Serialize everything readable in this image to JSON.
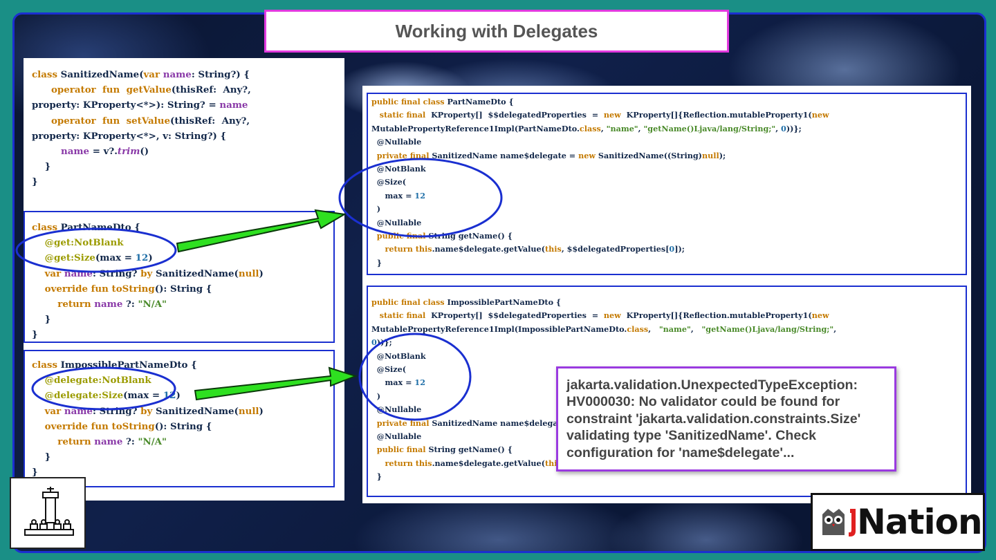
{
  "slide": {
    "title": "Working with Delegates"
  },
  "error": {
    "lines": [
      "jakarta.validation.UnexpectedTypeException:",
      "HV000030: No validator could be found for",
      "constraint 'jakarta.validation.constraints.Size'",
      "validating type 'SanitizedName'. Check",
      "configuration for 'name$delegate'..."
    ]
  },
  "branding": {
    "conference": "JNation",
    "left_logo_icon": "chess-pieces-icon",
    "right_logo_icon": "owl-icon"
  },
  "colors": {
    "title_border": "#e23adf",
    "frame_border": "#1a2fd0",
    "arrow_fill": "#2ee020",
    "error_border": "#9a3ae0",
    "keyword": "#c47a00",
    "annotation": "#9b9b00",
    "property": "#8a3aa8",
    "string": "#4a8a2a",
    "number": "#1f6fa8"
  }
}
